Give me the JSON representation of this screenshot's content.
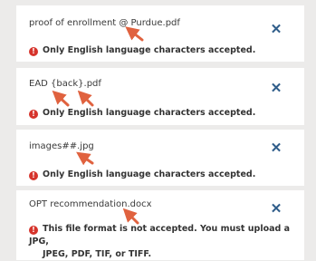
{
  "files": [
    {
      "name": "proof of enrollment @ Purdue.pdf",
      "error": "Only English language characters accepted.",
      "remove_icon": "close-icon",
      "remove_glyph": "✕"
    },
    {
      "name": "EAD {back}.pdf",
      "error": "Only English language characters accepted.",
      "remove_icon": "close-icon",
      "remove_glyph": "✕"
    },
    {
      "name": "images##.jpg",
      "error": "Only English language characters accepted.",
      "remove_icon": "close-icon",
      "remove_glyph": "✕"
    },
    {
      "name": "OPT recommendation.docx",
      "error_line1": "This file format is not accepted. You must upload a JPG,",
      "error_line2": "JPEG, PDF, TIF, or TIFF.",
      "remove_icon": "close-icon",
      "remove_glyph": "✕"
    }
  ],
  "error_icon_glyph": "!",
  "colors": {
    "accent": "#2f5d8a",
    "error": "#d6342c",
    "annotation_arrow": "#e0623f",
    "background": "#ecebea"
  }
}
